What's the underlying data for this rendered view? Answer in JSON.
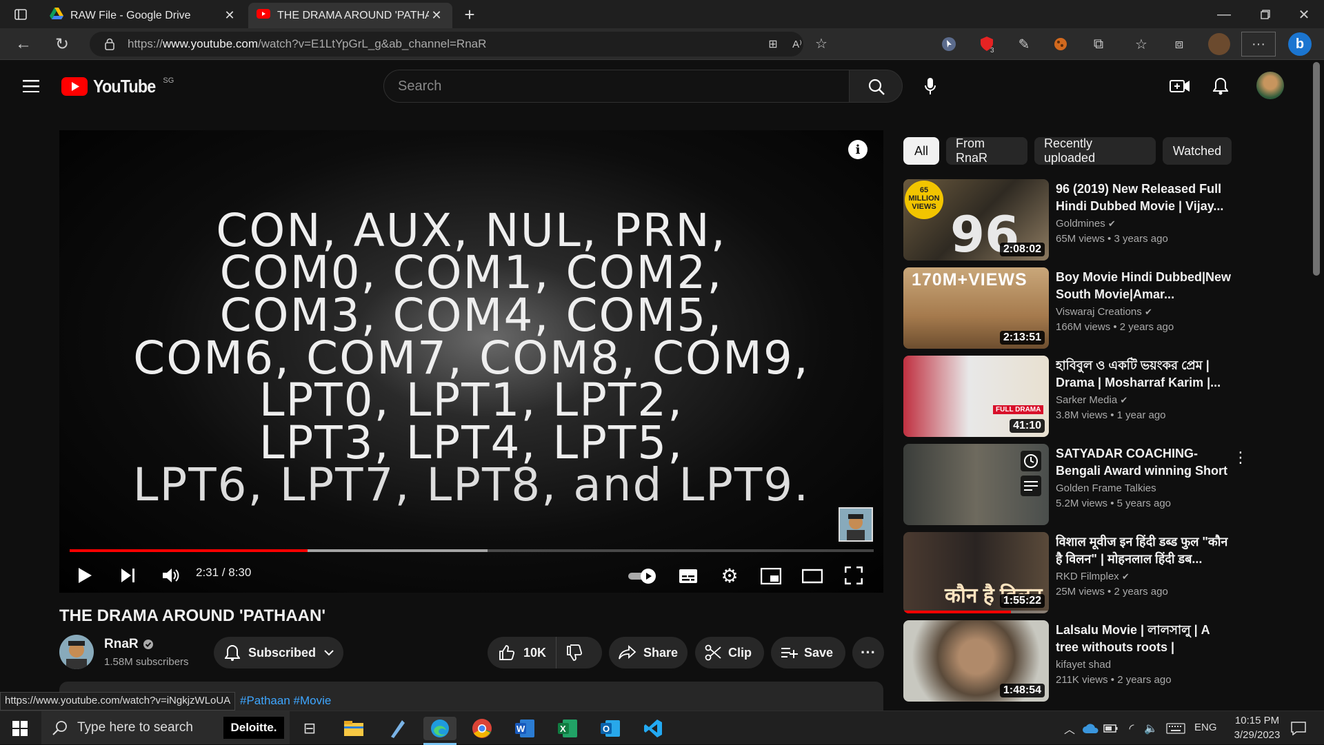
{
  "browser": {
    "tabs": [
      {
        "title": "RAW File - Google Drive",
        "icon": "google-drive-icon"
      },
      {
        "title": "THE DRAMA AROUND 'PATHAAN'",
        "icon": "youtube-icon"
      }
    ],
    "url_prefix": "https://",
    "url_host": "www.youtube.com",
    "url_path": "/watch?v=E1LtYpGrL_g&ab_channel=RnaR"
  },
  "youtube": {
    "logo_text": "YouTube",
    "region": "SG",
    "search_placeholder": "Search"
  },
  "player": {
    "lines": [
      "CON, AUX, NUL, PRN,",
      "COM0, COM1, COM2,",
      "COM3, COM4, COM5,",
      "COM6, COM7, COM8, COM9,",
      "LPT0, LPT1, LPT2,",
      "LPT3, LPT4, LPT5,",
      "LPT6, LPT7, LPT8, and LPT9."
    ],
    "time": "2:31 / 8:30",
    "played_fraction": 0.296,
    "buffered_fraction": 0.52
  },
  "video": {
    "title": "THE DRAMA AROUND 'PATHAAN'",
    "channel": "RnaR",
    "subscribers": "1.58M subscribers",
    "subscribed_label": "Subscribed",
    "likes": "10K",
    "share_label": "Share",
    "clip_label": "Clip",
    "save_label": "Save",
    "hashtags": "#Pathaan #Movie"
  },
  "status_url": "https://www.youtube.com/watch?v=iNgkjzWLoUA",
  "chips": [
    "All",
    "From RnaR",
    "Recently uploaded",
    "Watched"
  ],
  "recommendations": [
    {
      "title": "96 (2019) New Released Full Hindi Dubbed Movie | Vijay...",
      "channel": "Goldmines",
      "views": "65M views",
      "age": "3 years ago",
      "duration": "2:08:02",
      "thumb_text": "96"
    },
    {
      "title": "Boy Movie Hindi Dubbed|New South Movie|Amar...",
      "channel": "Viswaraj Creations",
      "views": "166M views",
      "age": "2 years ago",
      "duration": "2:13:51",
      "thumb_text": "170M+VIEWS"
    },
    {
      "title": "হাবিবুল ও একটি ভয়ংকর প্রেম | Drama | Mosharraf Karim |...",
      "channel": "Sarker Media",
      "views": "3.8M views",
      "age": "1 year ago",
      "duration": "41:10",
      "thumb_text": "FULL DRAMA"
    },
    {
      "title": "SATYADAR COACHING-Bengali Award winning Short Film--...",
      "channel": "Golden Frame Talkies",
      "views": "5.2M views",
      "age": "5 years ago",
      "duration": "",
      "thumb_text": ""
    },
    {
      "title": "विशाल मूवीज इन हिंदी डब्ड फुल \"कौन है विलन\" | मोहनलाल हिंदी डब...",
      "channel": "RKD Filmplex",
      "views": "25M views",
      "age": "2 years ago",
      "duration": "1:55:22",
      "thumb_text": "कौन है विलन"
    },
    {
      "title": "Lalsalu Movie | লালসালু | A tree withouts roots |",
      "channel": "kifayet shad",
      "views": "211K views",
      "age": "2 years ago",
      "duration": "1:48:54",
      "thumb_text": ""
    }
  ],
  "taskbar": {
    "search_placeholder": "Type here to search",
    "deloitte": "Deloitte.",
    "lang": "ENG",
    "time": "10:15 PM",
    "date": "3/29/2023"
  },
  "colors": {
    "accent_red": "#ff0000",
    "bg": "#0f0f0f",
    "chip_active": "#f1f1f1"
  }
}
